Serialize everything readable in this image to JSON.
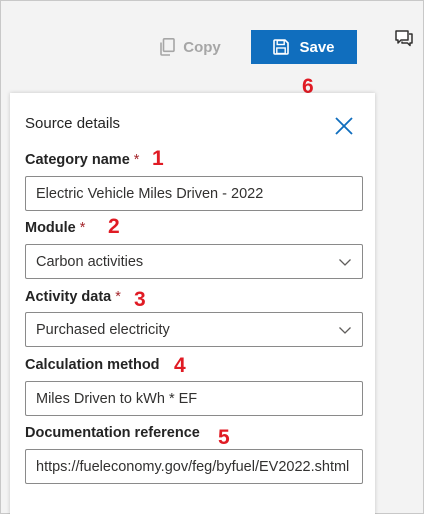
{
  "toolbar": {
    "copy_label": "Copy",
    "save_label": "Save",
    "copy_icon": "copy-icon",
    "save_icon": "save-floppy-icon",
    "chat_icon": "chat-feedback-icon"
  },
  "panel": {
    "title": "Source details",
    "close_icon": "close-icon",
    "required_marker": "*",
    "fields": {
      "category_name": {
        "label": "Category name",
        "value": "Electric Vehicle Miles Driven - 2022"
      },
      "module": {
        "label": "Module",
        "value": "Carbon activities"
      },
      "activity_data": {
        "label": "Activity data",
        "value": "Purchased electricity"
      },
      "calculation_method": {
        "label": "Calculation method",
        "value": "Miles Driven to kWh * EF"
      },
      "documentation_reference": {
        "label": "Documentation reference",
        "value": "https://fueleconomy.gov/feg/byfuel/EV2022.shtml"
      }
    }
  },
  "callouts": [
    "1",
    "2",
    "3",
    "4",
    "5",
    "6"
  ],
  "colors": {
    "primary": "#106ebe",
    "callout": "#e01b24",
    "required": "#a4262c",
    "disabled_text": "#a6a6a6",
    "background": "#f3f3f3"
  }
}
